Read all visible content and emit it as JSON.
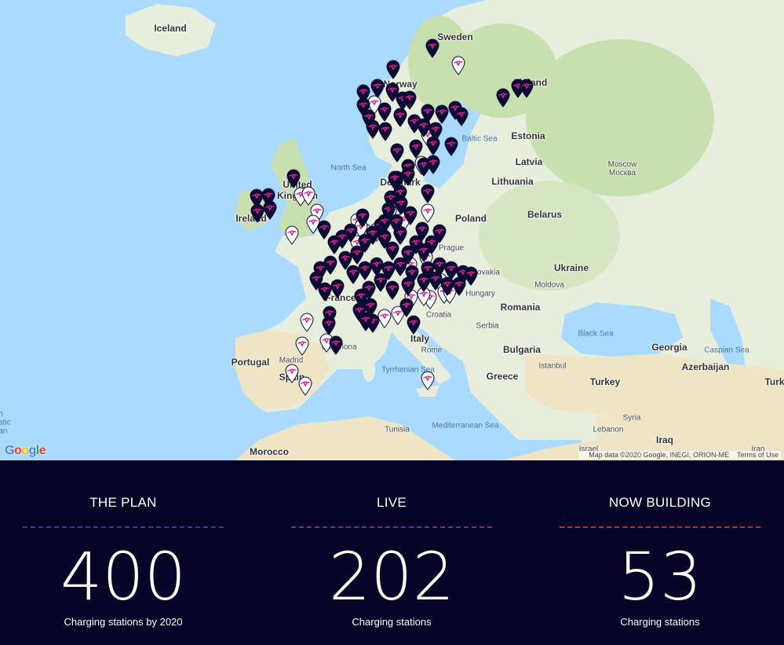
{
  "map": {
    "google_logo": "Google",
    "attribution": "Map data ©2020 Google, INEGI, ORION-ME",
    "terms": "Terms of Use",
    "colors": {
      "sea": "#aadaff",
      "land": "#e7efdc",
      "green": "#c8dfb0",
      "desert": "#efe4c4",
      "pin_live": "#0b0a35",
      "pin_planned": "#ffffff",
      "pin_logo": "#e0218a"
    },
    "labels": [
      {
        "key": "iceland",
        "text": "Iceland"
      },
      {
        "key": "sweden",
        "text": "Sweden"
      },
      {
        "key": "norway",
        "text": "Norway"
      },
      {
        "key": "finland",
        "text": "Finland"
      },
      {
        "key": "estonia",
        "text": "Estonia"
      },
      {
        "key": "latvia",
        "text": "Latvia"
      },
      {
        "key": "lithuania",
        "text": "Lithuania"
      },
      {
        "key": "baltic",
        "text": "Baltic Sea"
      },
      {
        "key": "northsea",
        "text": "North Sea"
      },
      {
        "key": "denmark",
        "text": "Denmark"
      },
      {
        "key": "moscow",
        "text": "Moscow\nМосква"
      },
      {
        "key": "uk",
        "text": "United Kingdom"
      },
      {
        "key": "ireland",
        "text": "Ireland"
      },
      {
        "key": "poland",
        "text": "Poland"
      },
      {
        "key": "belarus",
        "text": "Belarus"
      },
      {
        "key": "ukraine",
        "text": "Ukraine"
      },
      {
        "key": "prague",
        "text": "Prague"
      },
      {
        "key": "slovakia",
        "text": "Slovakia"
      },
      {
        "key": "hungary",
        "text": "Hungary"
      },
      {
        "key": "moldova",
        "text": "Moldova"
      },
      {
        "key": "romania",
        "text": "Romania"
      },
      {
        "key": "france",
        "text": "France"
      },
      {
        "key": "croatia",
        "text": "Croatia"
      },
      {
        "key": "serbia",
        "text": "Serbia"
      },
      {
        "key": "bulgaria",
        "text": "Bulgaria"
      },
      {
        "key": "blacksea",
        "text": "Black Sea"
      },
      {
        "key": "georgia",
        "text": "Georgia"
      },
      {
        "key": "caspian",
        "text": "Caspian Sea"
      },
      {
        "key": "azerbaijan",
        "text": "Azerbaijan"
      },
      {
        "key": "portugal",
        "text": "Portugal"
      },
      {
        "key": "madrid",
        "text": "Madrid"
      },
      {
        "key": "spain",
        "text": "Spain"
      },
      {
        "key": "barcelona",
        "text": "Barcelona"
      },
      {
        "key": "italy",
        "text": "Italy"
      },
      {
        "key": "rome",
        "text": "Rome"
      },
      {
        "key": "tyrrhenian",
        "text": "Tyrrhenian Sea"
      },
      {
        "key": "istanbul",
        "text": "Istanbul"
      },
      {
        "key": "greece",
        "text": "Greece"
      },
      {
        "key": "turkey",
        "text": "Turkey"
      },
      {
        "key": "turk",
        "text": "Turk"
      },
      {
        "key": "tunisia",
        "text": "Tunisia"
      },
      {
        "key": "medsea",
        "text": "Mediterranean Sea"
      },
      {
        "key": "syria",
        "text": "Syria"
      },
      {
        "key": "lebanon",
        "text": "Lebanon"
      },
      {
        "key": "iraq",
        "text": "Iraq"
      },
      {
        "key": "israel",
        "text": "Israel"
      },
      {
        "key": "iran",
        "text": "Iran"
      },
      {
        "key": "morocco",
        "text": "Morocco"
      },
      {
        "key": "atlantic",
        "text": "h\natic\nan"
      }
    ]
  },
  "stats": [
    {
      "heading": "THE PLAN",
      "value": "400",
      "caption": "Charging stations by 2020",
      "rule_color": "#3b3a8c"
    },
    {
      "heading": "LIVE",
      "value": "202",
      "caption": "Charging stations",
      "rule_color": "#7a2f7e"
    },
    {
      "heading": "NOW BUILDING",
      "value": "53",
      "caption": "Charging stations",
      "rule_color": "#c0283c"
    }
  ]
}
